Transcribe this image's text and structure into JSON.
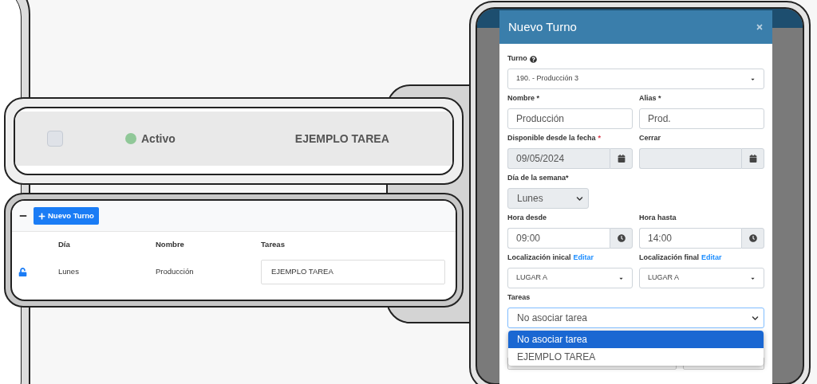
{
  "status_row": {
    "checked": false,
    "status": "Activo",
    "color": "#90c898",
    "task": "EJEMPLO TAREA"
  },
  "shift_table": {
    "expanded": true,
    "add_button": "Nuevo Turno",
    "columns": [
      "Día",
      "Nombre",
      "Tareas"
    ],
    "rows": [
      {
        "locked": false,
        "day": "Lunes",
        "name": "Producción",
        "task": "EJEMPLO TAREA"
      }
    ]
  },
  "modal": {
    "title": "Nuevo Turno",
    "rows": [
      {
        "fields": [
          {
            "kind": "select",
            "label": "Turno",
            "help": true,
            "value": "190. - Producción 3",
            "disabled": false
          }
        ]
      },
      {
        "fields": [
          {
            "kind": "text",
            "label": "Nombre *",
            "help": false,
            "value": "Producción",
            "disabled": false
          },
          {
            "kind": "text",
            "label": "Alias *",
            "help": false,
            "value": "Prod.",
            "disabled": false
          }
        ]
      },
      {
        "fields": [
          {
            "kind": "date",
            "label": "Disponible desde la fecha",
            "help": false,
            "required_mark": "*",
            "value": "09/05/2024",
            "disabled": true
          },
          {
            "kind": "date",
            "label": "Cerrar",
            "help": false,
            "disabled": true
          }
        ]
      },
      {
        "fields": [
          {
            "kind": "native_select",
            "label": "Día de la semana*",
            "help": false,
            "value": "Lunes",
            "disabled": true,
            "narrow": true,
            "focused": false
          }
        ]
      },
      {
        "fields": [
          {
            "kind": "time",
            "label": "Hora desde",
            "help": false,
            "value": "09:00",
            "disabled": false
          },
          {
            "kind": "time",
            "label": "Hora hasta",
            "help": false,
            "value": "14:00",
            "disabled": false
          }
        ]
      },
      {
        "fields": [
          {
            "kind": "select",
            "label": "Localización inical",
            "link": "Editar",
            "help": false,
            "value": "LUGAR A",
            "disabled": false
          },
          {
            "kind": "select",
            "label": "Localización final",
            "link": "Editar",
            "help": false,
            "value": "LUGAR A",
            "disabled": false
          }
        ]
      },
      {
        "fields": [
          {
            "kind": "native_select",
            "label": "Tareas",
            "help": false,
            "value": "No asociar tarea",
            "disabled": false,
            "narrow": false,
            "focused": true
          }
        ]
      }
    ],
    "dropdown": [
      {
        "label": "No asociar tarea",
        "selected": true
      },
      {
        "label": "EJEMPLO TAREA",
        "selected": false
      }
    ]
  }
}
